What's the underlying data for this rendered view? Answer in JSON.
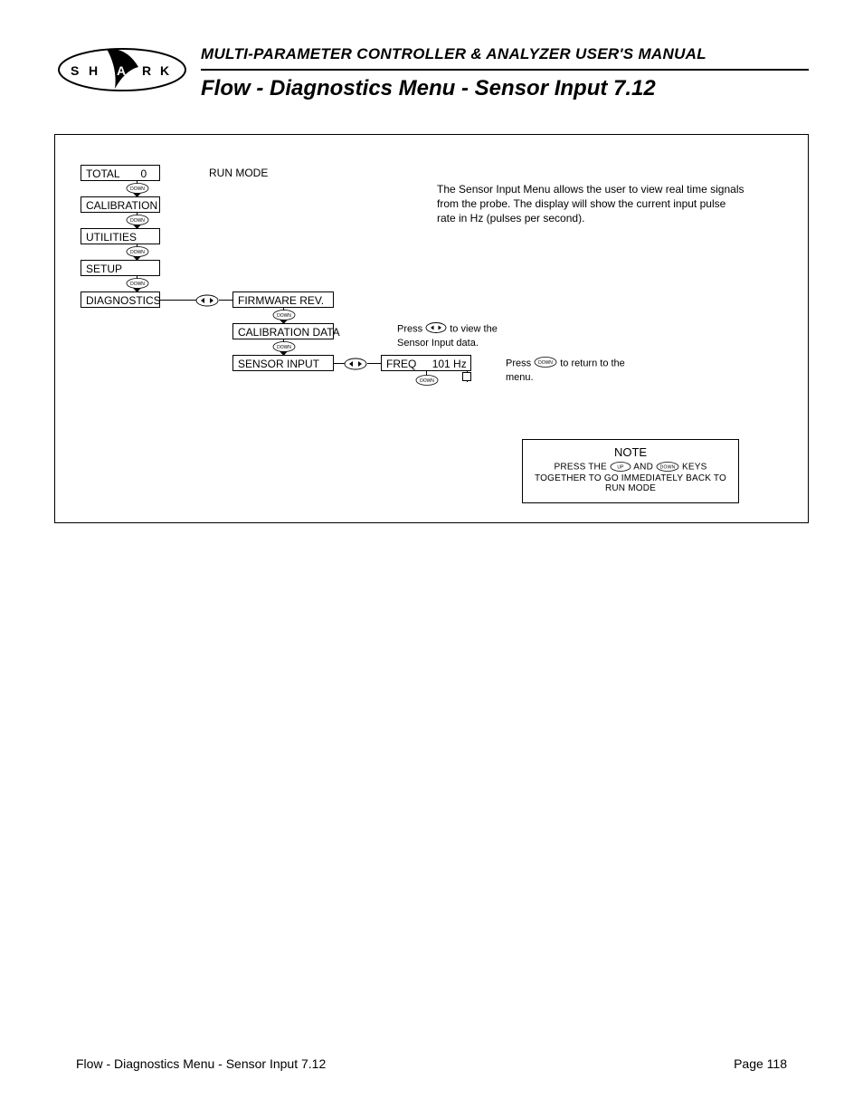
{
  "logo_text": "S H A R K",
  "header": {
    "manual_title": "MULTI-PARAMETER CONTROLLER & ANALYZER USER'S MANUAL",
    "page_title": "Flow - Diagnostics Menu - Sensor Input 7.12"
  },
  "menu_col1": {
    "total": "TOTAL",
    "total_val": "0",
    "calibration": "CALIBRATION",
    "utilities": "UTILITIES",
    "setup": "SETUP",
    "diagnostics": "DIAGNOSTICS"
  },
  "run_mode_label": "RUN MODE",
  "menu_col2": {
    "firmware": "FIRMWARE REV.",
    "caldata": "CALIBRATION DATA",
    "sensor_input": "SENSOR INPUT"
  },
  "menu_col3": {
    "freq_label": "FREQ",
    "freq_val": "101 Hz"
  },
  "key_labels": {
    "down": "DOWN",
    "up": "UP"
  },
  "description": "The Sensor Input Menu allows the user to view real time signals from the probe. The display will show the current input pulse rate in Hz (pulses per second).",
  "instr_view_a": "Press",
  "instr_view_b": "to view the Sensor Input data.",
  "instr_return_a": "Press",
  "instr_return_b": "to return to the menu.",
  "note": {
    "title": "NOTE",
    "line1a": "PRESS THE",
    "line1b": "AND",
    "line1c": "KEYS",
    "line2": "TOGETHER TO GO IMMEDIATELY BACK TO",
    "line3": "RUN MODE"
  },
  "footer": {
    "left": "Flow - Diagnostics Menu - Sensor Input 7.12",
    "right": "Page 118"
  }
}
